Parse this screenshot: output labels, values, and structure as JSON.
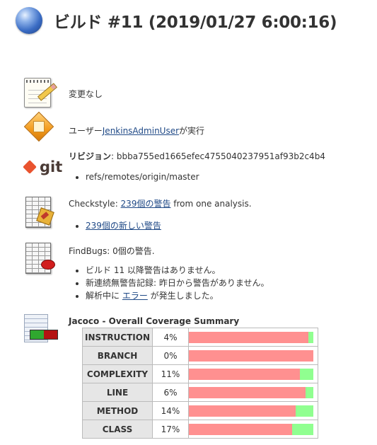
{
  "header": {
    "title": "ビルド #11 (2019/01/27 6:00:16)"
  },
  "changes": {
    "text": "変更なし"
  },
  "cause": {
    "prefix": "ユーザー",
    "user_link": "JenkinsAdminUser",
    "suffix": "が実行"
  },
  "git": {
    "logo_text": "git",
    "revision_label": "リビジョン",
    "revision_value": ": bbba755ed1665efec4755040237951af93b2c4b4",
    "branch": "refs/remotes/origin/master"
  },
  "checkstyle": {
    "prefix": "Checkstyle: ",
    "warnings_link": "239個の警告",
    "suffix": " from one analysis.",
    "new_warnings_link": "239個の新しい警告"
  },
  "findbugs": {
    "summary": "FindBugs: 0個の警告.",
    "items": [
      "ビルド 11 以降警告はありません。",
      "新連続無警告記録: 昨日から警告がありません。"
    ],
    "error_prefix": "解析中に ",
    "error_link": "エラー",
    "error_suffix": " が発生しました。"
  },
  "jacoco": {
    "title": "Jacoco - Overall Coverage Summary",
    "rows": [
      {
        "name": "INSTRUCTION",
        "pct": "4%",
        "covered": 0.04
      },
      {
        "name": "BRANCH",
        "pct": "0%",
        "covered": 0.0
      },
      {
        "name": "COMPLEXITY",
        "pct": "11%",
        "covered": 0.11
      },
      {
        "name": "LINE",
        "pct": "6%",
        "covered": 0.06
      },
      {
        "name": "METHOD",
        "pct": "14%",
        "covered": 0.14
      },
      {
        "name": "CLASS",
        "pct": "17%",
        "covered": 0.17
      }
    ],
    "colors": {
      "missed": "#ff9090",
      "covered": "#90ff90"
    }
  }
}
